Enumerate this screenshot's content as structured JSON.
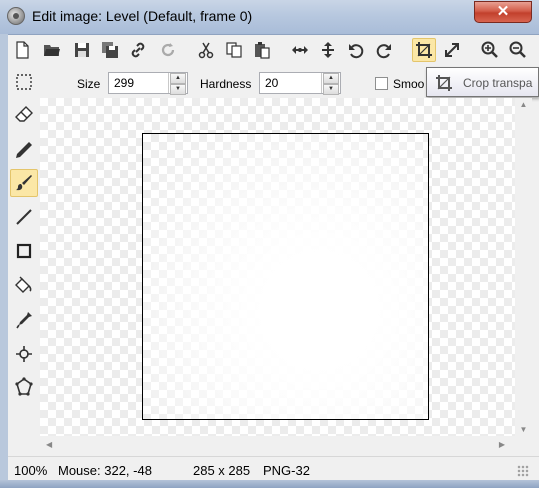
{
  "window": {
    "title": "Edit image: Level (Default, frame 0)",
    "close_glyph": "✕"
  },
  "toolbar": {
    "buttons": [
      {
        "name": "new-file-icon"
      },
      {
        "name": "open-folder-icon"
      },
      {
        "name": "save-icon"
      },
      {
        "name": "save-all-icon"
      },
      {
        "name": "link-icon"
      },
      {
        "name": "refresh-icon"
      },
      {
        "name": "cut-icon"
      },
      {
        "name": "copy-icon"
      },
      {
        "name": "paste-icon"
      },
      {
        "name": "move-horizontal-icon"
      },
      {
        "name": "move-vertical-icon"
      },
      {
        "name": "undo-icon"
      },
      {
        "name": "redo-icon"
      },
      {
        "name": "crop-icon"
      },
      {
        "name": "resize-icon"
      },
      {
        "name": "zoom-in-icon"
      },
      {
        "name": "zoom-out-icon"
      }
    ],
    "active": "crop-icon"
  },
  "options": {
    "size_label": "Size",
    "size_value": "299",
    "hardness_label": "Hardness",
    "hardness_value": "20",
    "smooth_label": "Smoo",
    "spin_up": "▲",
    "spin_down": "▼"
  },
  "tooltip": {
    "text": "Crop transpa"
  },
  "tools": {
    "items": [
      {
        "name": "selection-icon"
      },
      {
        "name": "eraser-icon"
      },
      {
        "name": "pencil-icon"
      },
      {
        "name": "brush-icon"
      },
      {
        "name": "line-icon"
      },
      {
        "name": "rectangle-icon"
      },
      {
        "name": "fill-bucket-icon"
      },
      {
        "name": "eyedropper-icon"
      },
      {
        "name": "origin-icon"
      },
      {
        "name": "polygon-icon"
      }
    ],
    "active": "brush-icon"
  },
  "scroll": {
    "up": "▲",
    "down": "▼",
    "left": "◀",
    "right": "▶"
  },
  "status": {
    "zoom": "100%",
    "mouse": "Mouse: 322, -48",
    "dimensions": "285 x 285",
    "format": "PNG-32"
  },
  "colors": {
    "active_tool_bg": "#fbe7a6",
    "close_button": "#c2402c",
    "titlebar": "#b7c8df"
  }
}
